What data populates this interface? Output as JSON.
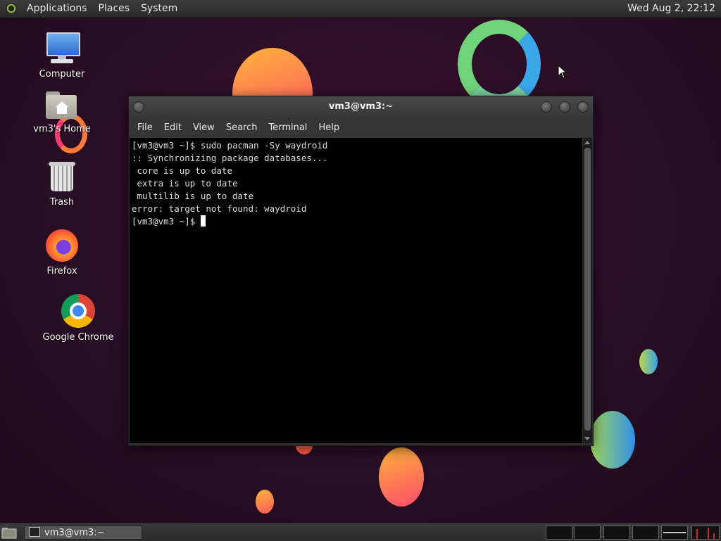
{
  "top_panel": {
    "menus": [
      "Applications",
      "Places",
      "System"
    ],
    "clock": "Wed Aug  2, 22:12"
  },
  "desktop_icons": {
    "computer": "Computer",
    "home": "vm3's Home",
    "trash": "Trash",
    "firefox": "Firefox",
    "chrome": "Google Chrome"
  },
  "window": {
    "title": "vm3@vm3:~",
    "menus": [
      "File",
      "Edit",
      "View",
      "Search",
      "Terminal",
      "Help"
    ],
    "terminal_lines": [
      "[vm3@vm3 ~]$ sudo pacman -Sy waydroid",
      ":: Synchronizing package databases...",
      " core is up to date",
      " extra is up to date",
      " multilib is up to date",
      "error: target not found: waydroid"
    ],
    "prompt": "[vm3@vm3 ~]$ "
  },
  "taskbar": {
    "task_label": "vm3@vm3:~"
  },
  "colors": {
    "background": "#2a0e24",
    "terminal_bg": "#000000",
    "terminal_fg": "#dddddd"
  }
}
